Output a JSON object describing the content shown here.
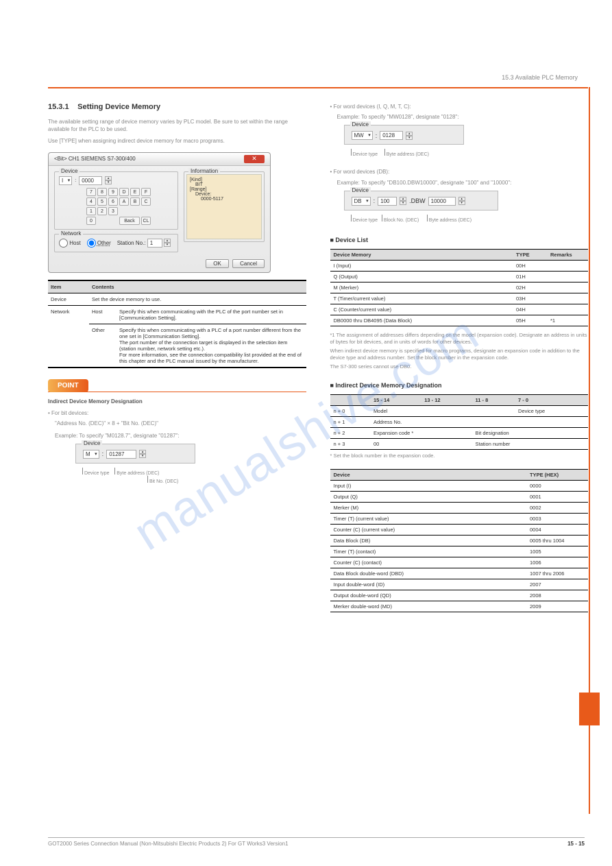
{
  "header": {
    "right_text": "15.3 Available PLC Memory"
  },
  "watermark": "manualshive.com",
  "left": {
    "sec_num": "15.3.1",
    "sec_title": "Setting Device Memory",
    "intro1": "The available setting range of device memory varies by PLC model. Be sure to set within the range available for the PLC to be used.",
    "intro2": "Use [TYPE] when assigning indirect device memory for macro programs.",
    "dialog": {
      "title": "<Bit> CH1 SIEMENS S7-300/400",
      "device_label": "Device",
      "type_sel": "I",
      "addr_val": "0000",
      "keys_row1": [
        "7",
        "8",
        "9",
        "D",
        "E",
        "F"
      ],
      "keys_row2": [
        "4",
        "5",
        "6",
        "A",
        "B",
        "C"
      ],
      "keys_row3": [
        "1",
        "2",
        "3"
      ],
      "keys_row4": [
        "0"
      ],
      "back": "Back",
      "cl": "CL",
      "info_label": "Information",
      "info_kind": "[Kind]",
      "info_kind_val": "BIT",
      "info_range": "[Range]",
      "info_device": "Device:",
      "info_range_val": "0000-5117",
      "network_label": "Network",
      "host": "Host",
      "other": "Other",
      "station_label": "Station No.:",
      "station_val": "1",
      "ok": "OK",
      "cancel": "Cancel"
    },
    "table": {
      "h1": "Item",
      "h2": "Contents",
      "r1a": "Device",
      "r1b": "Set the device memory to use.",
      "r2a": "Network",
      "r2ha": "Host",
      "r2hb": "Specify this when communicating with the PLC of the port number set in [Communication Setting].",
      "r3a": "Other",
      "r3b": "Specify this when communicating with a PLC of a port number different from the one set in [Communication Setting].\nThe port number of the connection target is displayed in the selection item (station number, network setting etc.).\nFor more information, see the connection compatibility list provided at the end of this chapter and the PLC manual issued by the manufacturer."
    },
    "point_label": "POINT",
    "point_text": "Indirect Device Memory Designation",
    "bullet_bit": "• For bit devices:",
    "bit_text": "\"Address No. (DEC)\" × 8 + \"Bit No. (DEC)\"",
    "bit_eg": "Example: To specify \"M0128.7\", designate \"01287\":",
    "widget1": {
      "label": "Device",
      "sel": "M",
      "val": "01287",
      "c1": "Device type",
      "c2": "Byte address (DEC)",
      "c3": "Bit No. (DEC)"
    }
  },
  "right": {
    "word_bullet": "• For word devices (I, Q, M, T, C):",
    "word_eg": "Example: To specify \"MW0128\", designate \"0128\":",
    "widget2": {
      "label": "Device",
      "sel": "MW",
      "val": "0128",
      "c1": "Device type",
      "c2": "Byte address (DEC)"
    },
    "word_bullet2": "• For word devices (DB):",
    "word_eg2": "Example: To specify \"DB100.DBW10000\", designate \"100\" and \"10000\":",
    "widget3": {
      "label": "Device",
      "sel": "DB",
      "val1": "100",
      "mid": ".DBW",
      "val2": "10000",
      "c1": "Device type",
      "c2": "Block No. (DEC)",
      "c3": "Byte address (DEC)"
    },
    "device_list_title": "■ Device List",
    "dl_table": {
      "h1": "Device Memory",
      "h2": "TYPE",
      "h3": "Remarks",
      "rows": [
        [
          "I (Input)",
          "00H",
          ""
        ],
        [
          "Q (Output)",
          "01H",
          ""
        ],
        [
          "M (Merker)",
          "02H",
          ""
        ],
        [
          "T (Timer/current value)",
          "03H",
          ""
        ],
        [
          "C (Counter/current value)",
          "04H",
          ""
        ],
        [
          "DB0000 thru DB4095 (Data Block)",
          "05H",
          "*1"
        ]
      ]
    },
    "note1": "*1 The assignment of addresses differs depending on the model (expansion code). Designate an address in units of bytes for bit devices, and in units of words for other devices.",
    "note2": "When indirect device memory is specified for macro programs, designate an expansion code in addition to the device type and address number. Set the block number in the expansion code.",
    "note3": "The S7-300 series cannot use DB0.",
    "indirect_title": "■ Indirect Device Memory Designation",
    "ind_table": {
      "h1": "15 - 14",
      "h2": "13 - 12",
      "h3": "11 - 8",
      "h4": "7 - 0",
      "r1": [
        "n + 0",
        "Model",
        "",
        "Device type"
      ],
      "r2": [
        "n + 1",
        "Address No."
      ],
      "r3": [
        "n + 2",
        "Expansion code *",
        "Bit designation"
      ],
      "r4": [
        "n + 3",
        "00",
        "Station number"
      ]
    },
    "ind_note": "* Set the block number in the expansion code.",
    "type_table": {
      "h1": "Device",
      "h2": "TYPE (HEX)",
      "rows": [
        [
          "Input (I)",
          "0000"
        ],
        [
          "Output (Q)",
          "0001"
        ],
        [
          "Merker (M)",
          "0002"
        ],
        [
          "Timer (T) (current value)",
          "0003"
        ],
        [
          "Counter (C) (current value)",
          "0004"
        ],
        [
          "Data Block (DB)",
          "0005 thru 1004"
        ],
        [
          "Timer (T) (contact)",
          "1005"
        ],
        [
          "Counter (C) (contact)",
          "1006"
        ],
        [
          "Data Block double-word (DBD)",
          "1007 thru 2006"
        ],
        [
          "Input double-word (ID)",
          "2007"
        ],
        [
          "Output double-word (QD)",
          "2008"
        ],
        [
          "Merker double-word (MD)",
          "2009"
        ]
      ]
    }
  },
  "footer": {
    "left": "GOT2000 Series Connection Manual (Non-Mitsubishi Electric Products 2) For GT Works3 Version1",
    "right": "15 - 15"
  }
}
